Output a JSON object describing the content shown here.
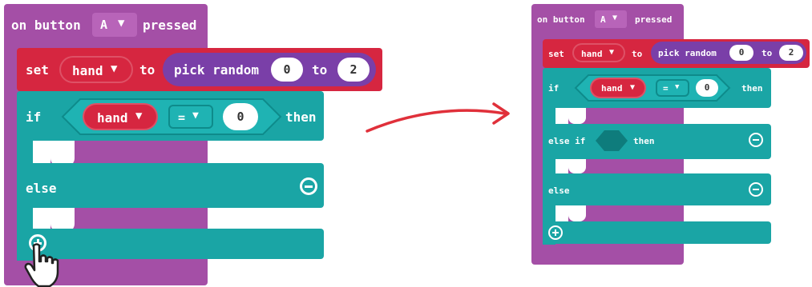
{
  "left": {
    "event": {
      "prefix": "on button",
      "button": "A",
      "suffix": "pressed"
    },
    "set": {
      "label": "set",
      "var": "hand",
      "to": "to",
      "random_label": "pick random",
      "min": "0",
      "to2": "to",
      "max": "2"
    },
    "if": {
      "label": "if",
      "var": "hand",
      "op": "=",
      "value": "0",
      "then": "then"
    },
    "else": {
      "label": "else"
    }
  },
  "right": {
    "event": {
      "prefix": "on button",
      "button": "A",
      "suffix": "pressed"
    },
    "set": {
      "label": "set",
      "var": "hand",
      "to": "to",
      "random_label": "pick random",
      "min": "0",
      "to2": "to",
      "max": "2"
    },
    "if": {
      "label": "if",
      "var": "hand",
      "op": "=",
      "value": "0",
      "then": "then"
    },
    "elseif": {
      "label": "else if",
      "then": "then"
    },
    "else": {
      "label": "else"
    }
  },
  "icons": {
    "arrow": "curved-arrow-icon",
    "cursor": "hand-cursor-icon",
    "plus": "add-circle-icon",
    "minus": "remove-circle-icon"
  },
  "colors": {
    "event": "#a44fa6",
    "set": "#d62640",
    "logic": "#1aa5a5",
    "math": "#7a3fa8",
    "arrow": "#e0303a"
  }
}
